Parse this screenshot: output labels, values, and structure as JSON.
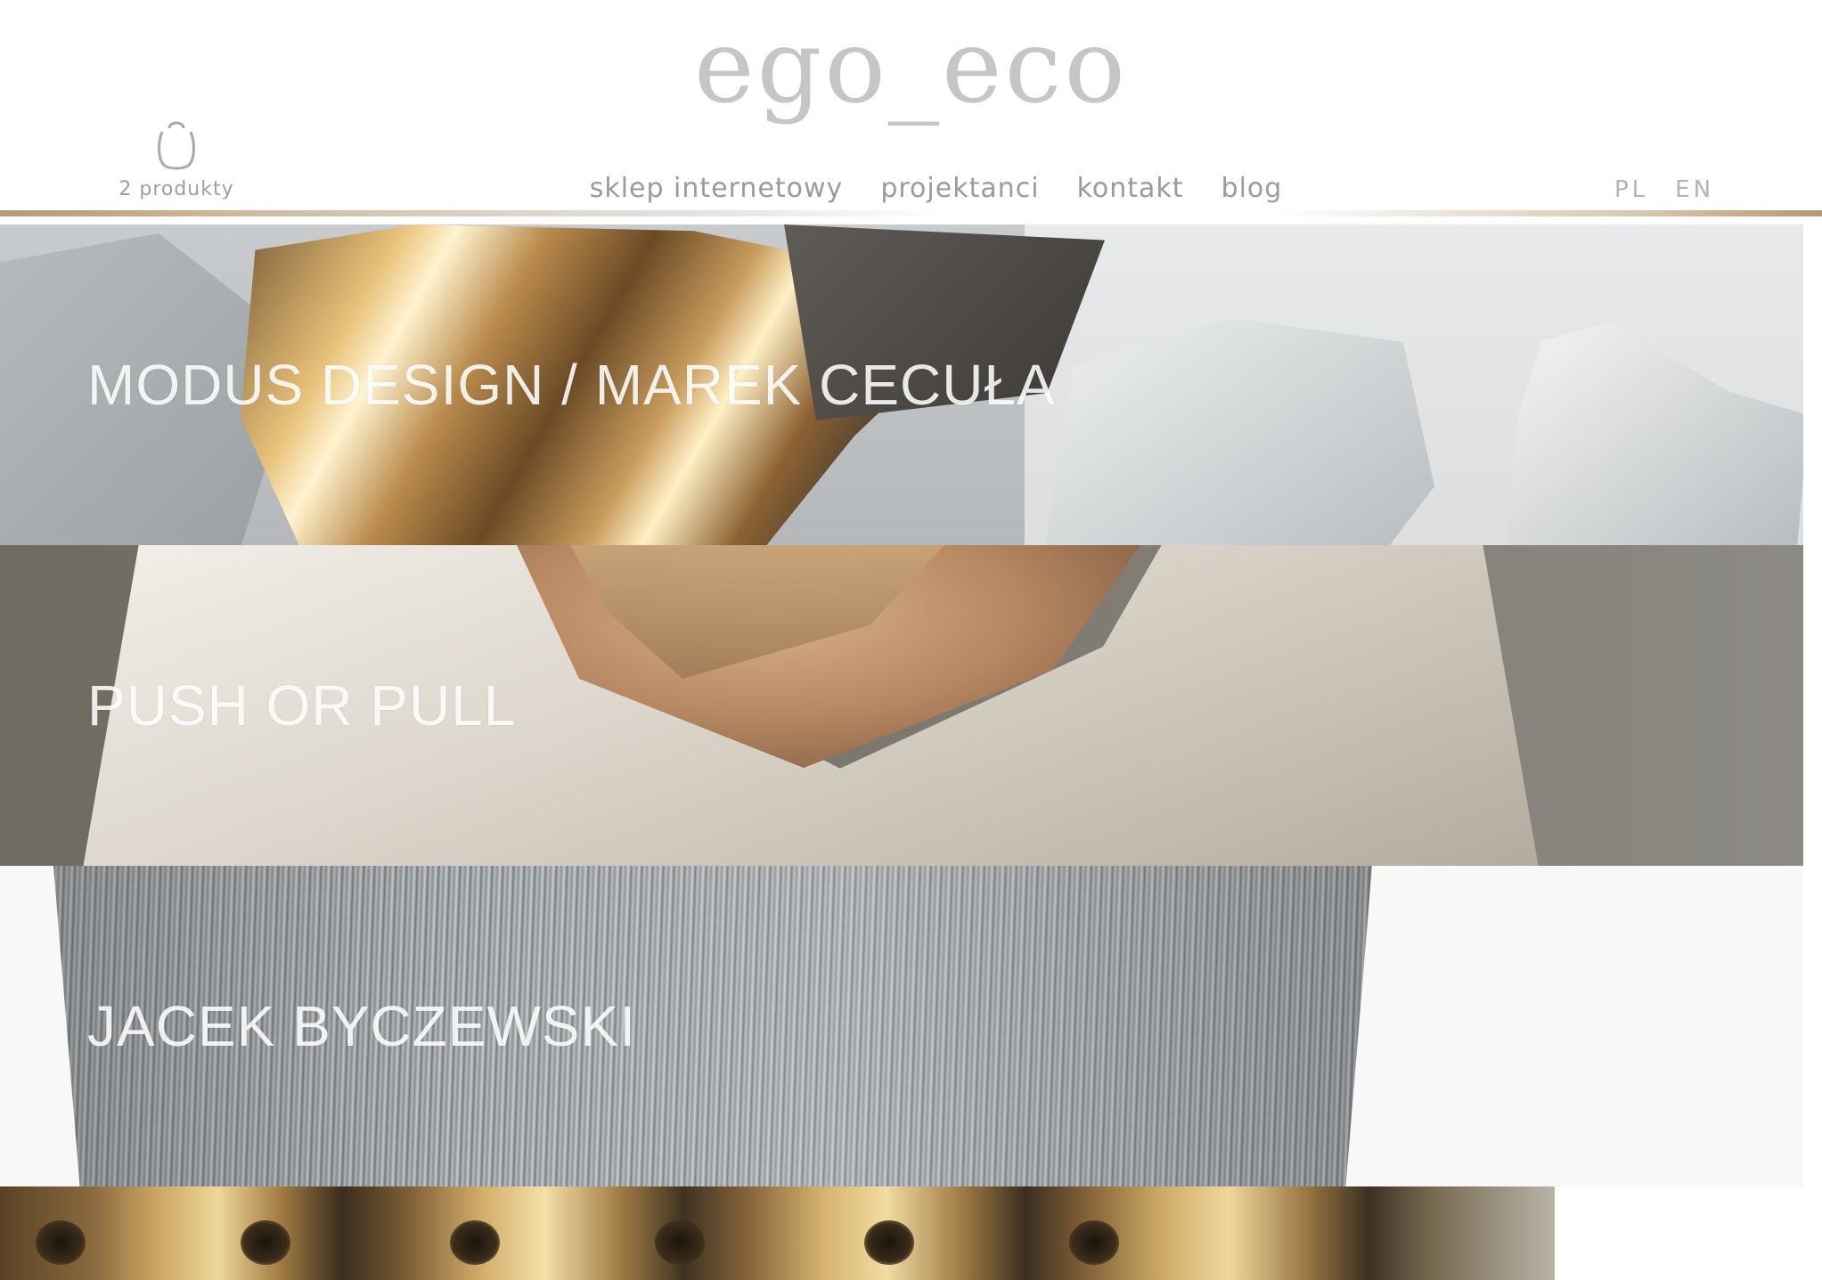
{
  "brand": {
    "logo_text": "ego_eco"
  },
  "cart": {
    "icon": "shopping-bag-icon",
    "count_label": "2 produkty"
  },
  "nav": {
    "items": [
      {
        "label": "sklep internetowy"
      },
      {
        "label": "projektanci"
      },
      {
        "label": "kontakt"
      },
      {
        "label": "blog"
      }
    ]
  },
  "language": {
    "options": [
      "PL",
      "EN"
    ]
  },
  "banners": [
    {
      "title": "MODUS DESIGN / MAREK CECUŁA",
      "image": "ceramic-stones-with-gold"
    },
    {
      "title": "PUSH OR PULL",
      "image": "white-blouse-shoulder"
    },
    {
      "title": "JACEK BYCZEWSKI",
      "image": "steel-wires"
    },
    {
      "title": "",
      "image": "gold-rings"
    }
  ],
  "colors": {
    "logo": "#c6c6c6",
    "nav_text": "#9b9b9b",
    "rule_gold": "#b39a7a",
    "banner_text": "#ffffff"
  }
}
